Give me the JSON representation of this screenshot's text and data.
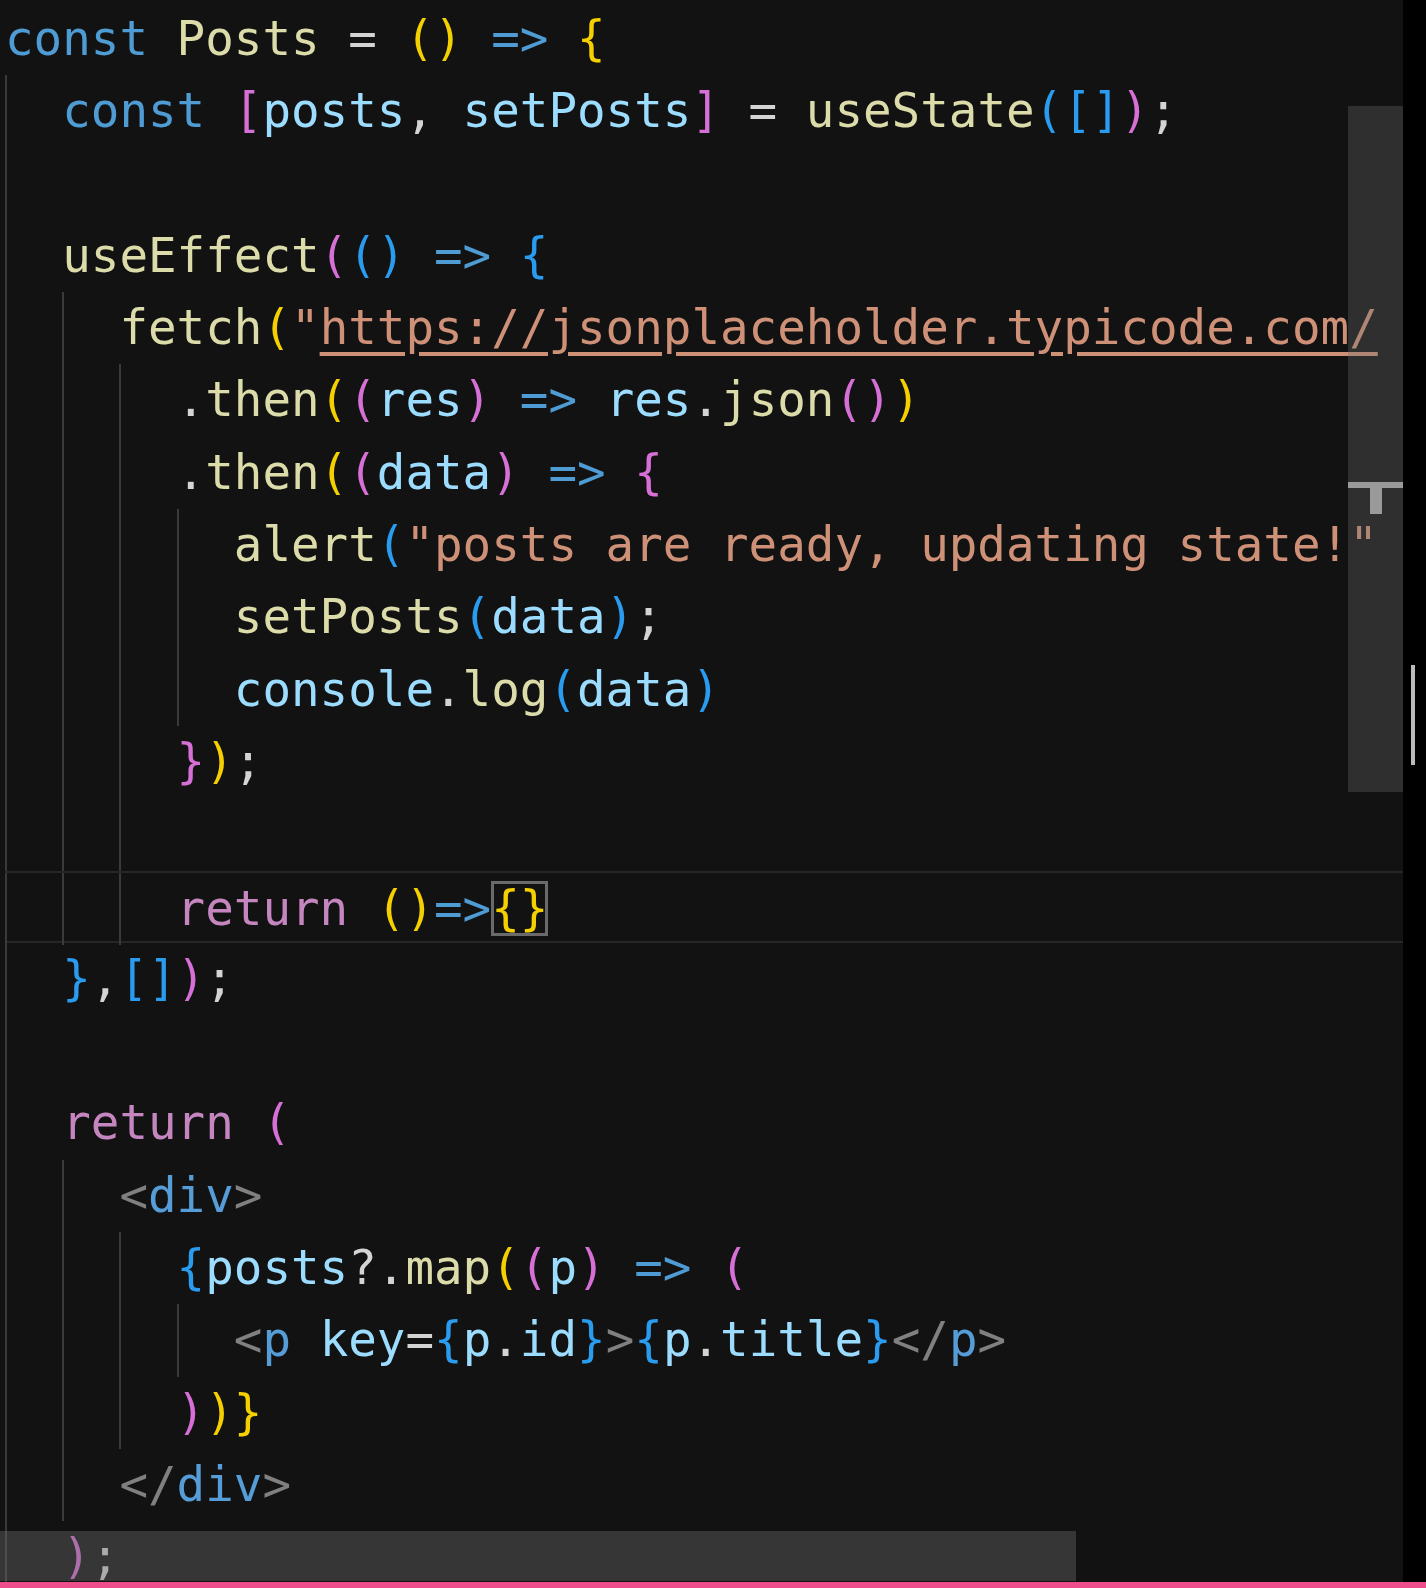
{
  "editor": {
    "lines": [
      {
        "current": false,
        "tokens": [
          {
            "text": "const",
            "kind": "keyword"
          },
          {
            "text": " Posts",
            "kind": "func"
          },
          {
            "text": " = ",
            "kind": "punct"
          },
          {
            "text": "()",
            "kind": "b1"
          },
          {
            "text": " =>",
            "kind": "keyword"
          },
          {
            "text": " {",
            "kind": "b1"
          }
        ]
      },
      {
        "current": false,
        "tokens": [
          {
            "text": "  const",
            "kind": "keyword"
          },
          {
            "text": " [",
            "kind": "b2"
          },
          {
            "text": "posts",
            "kind": "var"
          },
          {
            "text": ", ",
            "kind": "punct"
          },
          {
            "text": "setPosts",
            "kind": "var"
          },
          {
            "text": "]",
            "kind": "b2"
          },
          {
            "text": " = ",
            "kind": "punct"
          },
          {
            "text": "useState",
            "kind": "func"
          },
          {
            "text": "(",
            "kind": "b3"
          },
          {
            "text": "[]",
            "kind": "b3"
          },
          {
            "text": ")",
            "kind": "b2"
          },
          {
            "text": ";",
            "kind": "punct"
          }
        ]
      },
      {
        "current": false
      },
      {
        "current": false,
        "tokens": [
          {
            "text": "  useEffect",
            "kind": "func"
          },
          {
            "text": "(",
            "kind": "b2"
          },
          {
            "text": "()",
            "kind": "b3"
          },
          {
            "text": " =>",
            "kind": "keyword"
          },
          {
            "text": " {",
            "kind": "b3"
          }
        ]
      },
      {
        "current": false,
        "tokens": [
          {
            "text": "    fetch",
            "kind": "func"
          },
          {
            "text": "(",
            "kind": "b1"
          },
          {
            "text": "\"",
            "kind": "string"
          },
          {
            "text": "https://jsonplaceholder.typicode.com/",
            "kind": "link"
          }
        ]
      },
      {
        "current": false,
        "tokens": [
          {
            "text": "      .",
            "kind": "punct"
          },
          {
            "text": "then",
            "kind": "func"
          },
          {
            "text": "(",
            "kind": "b1"
          },
          {
            "text": "(",
            "kind": "b2"
          },
          {
            "text": "res",
            "kind": "var"
          },
          {
            "text": ")",
            "kind": "b2"
          },
          {
            "text": " =>",
            "kind": "keyword"
          },
          {
            "text": " res",
            "kind": "var"
          },
          {
            "text": ".",
            "kind": "punct"
          },
          {
            "text": "json",
            "kind": "func"
          },
          {
            "text": "()",
            "kind": "b2"
          },
          {
            "text": ")",
            "kind": "b1"
          }
        ]
      },
      {
        "current": false,
        "tokens": [
          {
            "text": "      .",
            "kind": "punct"
          },
          {
            "text": "then",
            "kind": "func"
          },
          {
            "text": "(",
            "kind": "b1"
          },
          {
            "text": "(",
            "kind": "b2"
          },
          {
            "text": "data",
            "kind": "var"
          },
          {
            "text": ")",
            "kind": "b2"
          },
          {
            "text": " =>",
            "kind": "keyword"
          },
          {
            "text": " {",
            "kind": "b2"
          }
        ]
      },
      {
        "current": false,
        "tokens": [
          {
            "text": "        alert",
            "kind": "func"
          },
          {
            "text": "(",
            "kind": "b3"
          },
          {
            "text": "\"posts are ready, updating state!\"",
            "kind": "string"
          }
        ]
      },
      {
        "current": false,
        "tokens": [
          {
            "text": "        setPosts",
            "kind": "func"
          },
          {
            "text": "(",
            "kind": "b3"
          },
          {
            "text": "data",
            "kind": "var"
          },
          {
            "text": ")",
            "kind": "b3"
          },
          {
            "text": ";",
            "kind": "punct"
          }
        ]
      },
      {
        "current": false,
        "tokens": [
          {
            "text": "        console",
            "kind": "var"
          },
          {
            "text": ".",
            "kind": "punct"
          },
          {
            "text": "log",
            "kind": "func"
          },
          {
            "text": "(",
            "kind": "b3"
          },
          {
            "text": "data",
            "kind": "var"
          },
          {
            "text": ")",
            "kind": "b3"
          }
        ]
      },
      {
        "current": false,
        "tokens": [
          {
            "text": "      }",
            "kind": "b2"
          },
          {
            "text": ")",
            "kind": "b1"
          },
          {
            "text": ";",
            "kind": "punct"
          }
        ]
      },
      {
        "current": false
      },
      {
        "current": true,
        "tokens": [
          {
            "text": "      return",
            "kind": "control"
          },
          {
            "text": " ()",
            "kind": "b1"
          },
          {
            "text": "=>",
            "kind": "keyword"
          },
          {
            "text": "{}",
            "kind": "match"
          }
        ]
      },
      {
        "current": false,
        "tokens": [
          {
            "text": "  }",
            "kind": "b3"
          },
          {
            "text": ",",
            "kind": "punct"
          },
          {
            "text": "[]",
            "kind": "b3"
          },
          {
            "text": ")",
            "kind": "b2"
          },
          {
            "text": ";",
            "kind": "punct"
          }
        ]
      },
      {
        "current": false
      },
      {
        "current": false,
        "tokens": [
          {
            "text": "  return",
            "kind": "control"
          },
          {
            "text": " (",
            "kind": "b2"
          }
        ]
      },
      {
        "current": false,
        "tokens": [
          {
            "text": "    <",
            "kind": "tagmark"
          },
          {
            "text": "div",
            "kind": "tag"
          },
          {
            "text": ">",
            "kind": "tagmark"
          }
        ]
      },
      {
        "current": false,
        "tokens": [
          {
            "text": "      {",
            "kind": "b3"
          },
          {
            "text": "posts",
            "kind": "var"
          },
          {
            "text": "?.",
            "kind": "punct"
          },
          {
            "text": "map",
            "kind": "func"
          },
          {
            "text": "(",
            "kind": "b1"
          },
          {
            "text": "(",
            "kind": "b2"
          },
          {
            "text": "p",
            "kind": "var"
          },
          {
            "text": ")",
            "kind": "b2"
          },
          {
            "text": " =>",
            "kind": "keyword"
          },
          {
            "text": " (",
            "kind": "b2"
          }
        ]
      },
      {
        "current": false,
        "tokens": [
          {
            "text": "        <",
            "kind": "tagmark"
          },
          {
            "text": "p",
            "kind": "tag"
          },
          {
            "text": " key",
            "kind": "var"
          },
          {
            "text": "=",
            "kind": "punct"
          },
          {
            "text": "{",
            "kind": "b3"
          },
          {
            "text": "p",
            "kind": "var"
          },
          {
            "text": ".",
            "kind": "punct"
          },
          {
            "text": "id",
            "kind": "var"
          },
          {
            "text": "}",
            "kind": "b3"
          },
          {
            "text": ">",
            "kind": "tagmark"
          },
          {
            "text": "{",
            "kind": "b3"
          },
          {
            "text": "p",
            "kind": "var"
          },
          {
            "text": ".",
            "kind": "punct"
          },
          {
            "text": "title",
            "kind": "var"
          },
          {
            "text": "}",
            "kind": "b3"
          },
          {
            "text": "</",
            "kind": "tagmark"
          },
          {
            "text": "p",
            "kind": "tag"
          },
          {
            "text": ">",
            "kind": "tagmark"
          }
        ]
      },
      {
        "current": false,
        "tokens": [
          {
            "text": "      )",
            "kind": "b2"
          },
          {
            "text": ")",
            "kind": "b1"
          },
          {
            "text": "}",
            "kind": "b1"
          }
        ]
      },
      {
        "current": false,
        "tokens": [
          {
            "text": "    </",
            "kind": "tagmark"
          },
          {
            "text": "div",
            "kind": "tag"
          },
          {
            "text": ">",
            "kind": "tagmark"
          }
        ]
      },
      {
        "current": false,
        "tokens": [
          {
            "text": "  )",
            "kind": "b2"
          },
          {
            "text": ";",
            "kind": "punct"
          }
        ]
      }
    ]
  }
}
